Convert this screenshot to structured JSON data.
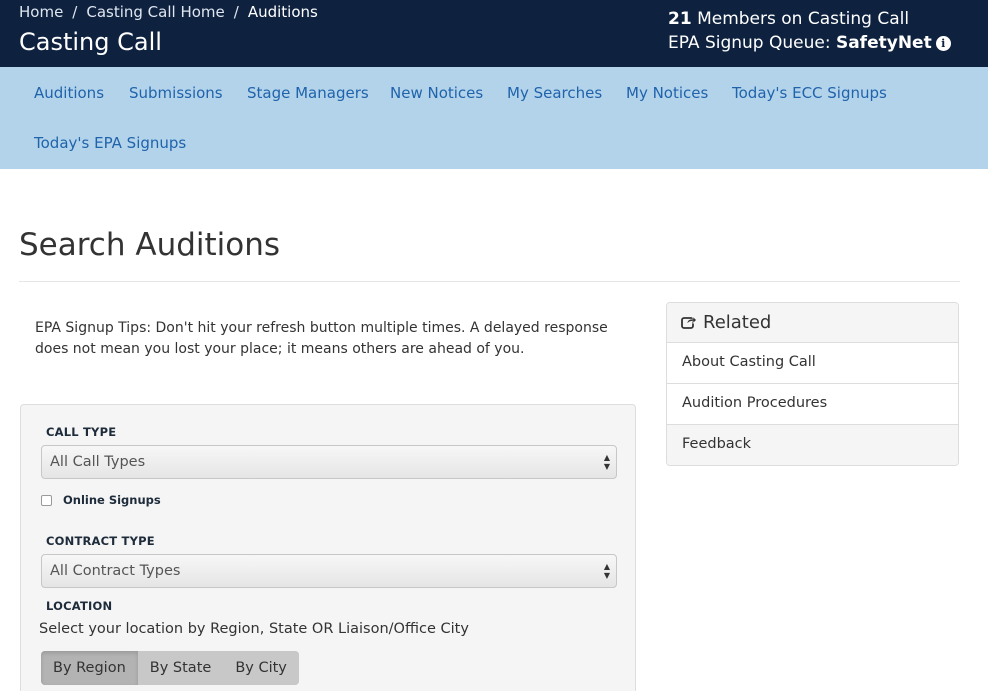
{
  "header": {
    "breadcrumb": [
      "Home",
      "Casting Call Home",
      "Auditions"
    ],
    "breadcrumb_sep": "/",
    "app_title": "Casting Call",
    "member_count": "21",
    "member_text": "Members on Casting Call",
    "queue_label": "EPA Signup Queue:",
    "queue_value": "SafetyNet",
    "info_icon_glyph": "i"
  },
  "nav": {
    "items": [
      "Auditions",
      "Submissions",
      "Stage Managers",
      "New Notices",
      "My Searches",
      "My Notices",
      "Today's ECC Signups",
      "Today's EPA Signups"
    ]
  },
  "page": {
    "title": "Search Auditions",
    "tips": "EPA Signup Tips: Don't hit your refresh button multiple times. A delayed response does not mean you lost your place; it means others are ahead of you."
  },
  "search": {
    "call_type_label": "CALL TYPE",
    "call_type_value": "All Call Types",
    "online_signups_label": "Online Signups",
    "online_signups_checked": false,
    "contract_type_label": "CONTRACT TYPE",
    "contract_type_value": "All Contract Types",
    "location_label": "LOCATION",
    "location_help": "Select your location by Region, State OR Liaison/Office City",
    "location_tabs": [
      "By Region",
      "By State",
      "By City"
    ],
    "location_active_tab": "By Region",
    "select_arrows": "▲\n▼"
  },
  "related": {
    "title": "Related",
    "items": [
      "About Casting Call",
      "Audition Procedures",
      "Feedback"
    ]
  },
  "colors": {
    "header_bg": "#0e2240",
    "nav_bg": "#b3d3eb",
    "nav_link": "#1f63ab",
    "panel_bg": "#f5f5f5"
  }
}
